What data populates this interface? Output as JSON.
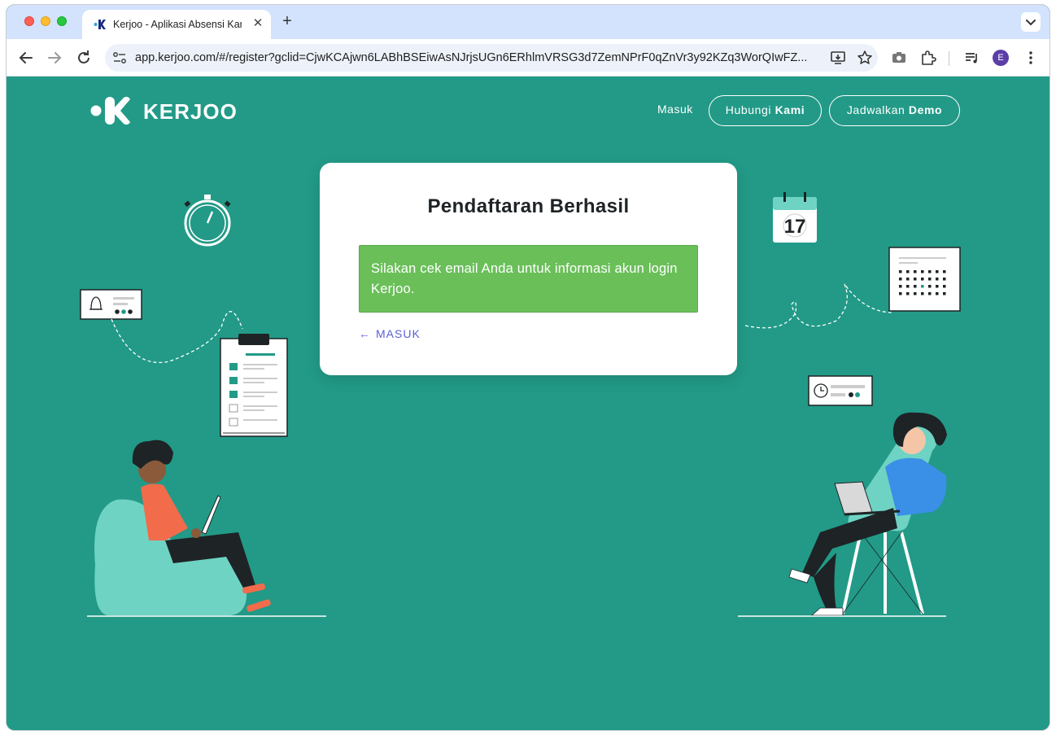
{
  "browser": {
    "tab_title": "Kerjoo - Aplikasi Absensi Kary",
    "new_tab_label": "+",
    "close_tab_label": "✕",
    "url": "app.kerjoo.com/#/register?gclid=CjwKCAjwn6LABhBSEiwAsNJrjsUGn6ERhlmVRSG3d7ZemNPrF0qZnVr3y92KZq3WorQIwFZ...",
    "profile_initial": "E"
  },
  "header": {
    "logo_text": "KERJOO",
    "nav_login": "Masuk",
    "contact_prefix": "Hubungi ",
    "contact_bold": "Kami",
    "demo_prefix": "Jadwalkan ",
    "demo_bold": "Demo"
  },
  "card": {
    "title": "Pendaftaran Berhasil",
    "message": "Silakan cek email Anda untuk informasi akun login Kerjoo.",
    "back_arrow": "←",
    "back_label": "MASUK"
  },
  "illustrations": {
    "calendar_day": "17"
  },
  "colors": {
    "page_bg": "#229a87",
    "alert_bg": "#6abf59",
    "link": "#5a5fd6",
    "teal_light": "#6fd3c4",
    "orange": "#f26b4a",
    "blue_shirt": "#3a8fe6"
  }
}
